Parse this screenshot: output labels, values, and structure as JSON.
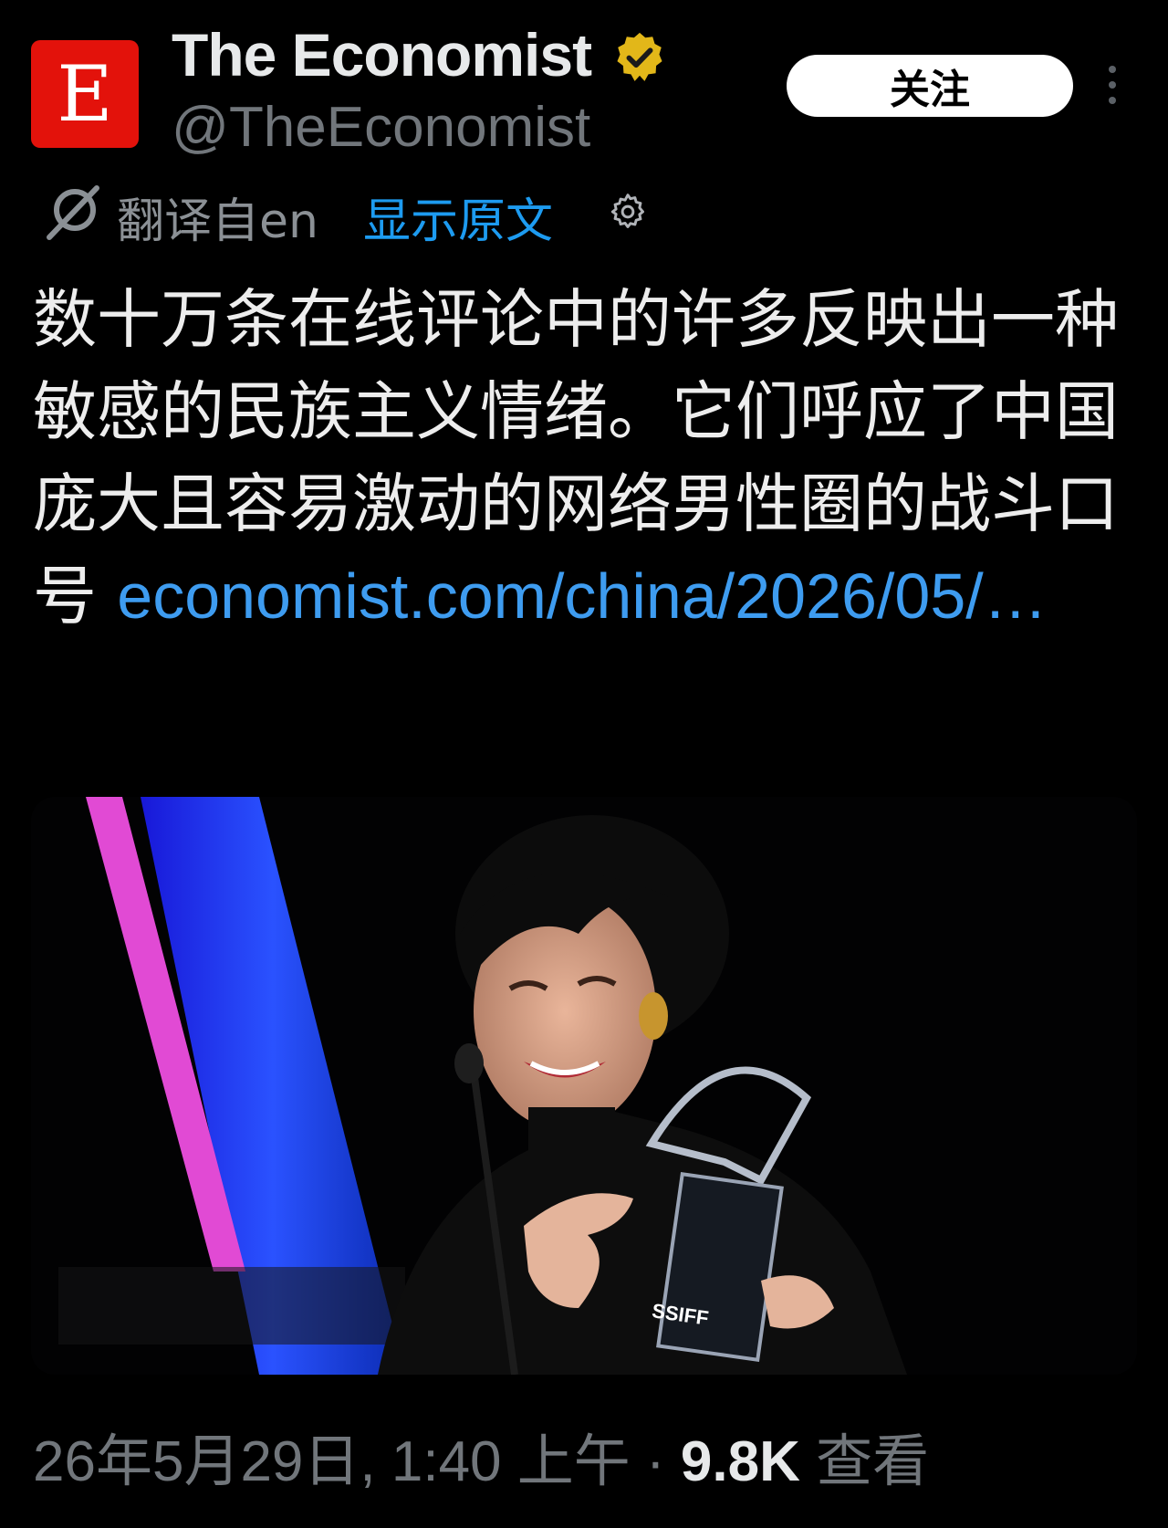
{
  "account": {
    "avatar_letter": "E",
    "display_name": "The Economist",
    "handle": "@TheEconomist",
    "verified_icon": "verified-badge-icon",
    "follow_label": "关注",
    "more_icon": "more-vertical-icon"
  },
  "translation": {
    "label": "翻译自en",
    "show_original": "显示原文",
    "icons": [
      "translate-icon",
      "gear-icon"
    ]
  },
  "tweet": {
    "text": "数十万条在线评论中的许多反映出一种敏感的民族主义情绪。它们呼应了中国庞大且容易激动的网络男性圈的战斗口号 ",
    "link": "economist.com/china/2026/05/…"
  },
  "media": {
    "trophy_text": "SSIFF"
  },
  "meta": {
    "timestamp": "26年5月29日, 1:40 上午",
    "separator": " · ",
    "views_count": "9.8K",
    "views_label": " 查看"
  },
  "colors": {
    "background": "#000000",
    "brand_red": "#e3120b",
    "link_blue": "#1d9bf0",
    "verified_gold": "#e2b719",
    "muted": "#71767b"
  }
}
